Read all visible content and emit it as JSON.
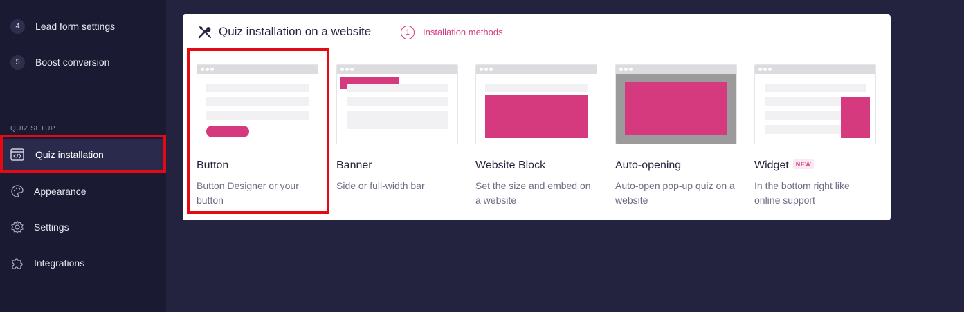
{
  "sidebar": {
    "steps": [
      {
        "num": "4",
        "label": "Lead form settings"
      },
      {
        "num": "5",
        "label": "Boost conversion"
      }
    ],
    "section_title": "QUIZ SETUP",
    "nav": [
      {
        "label": "Quiz installation",
        "icon": "code-window-icon",
        "active": true
      },
      {
        "label": "Appearance",
        "icon": "palette-icon"
      },
      {
        "label": "Settings",
        "icon": "gear-icon"
      },
      {
        "label": "Integrations",
        "icon": "puzzle-icon"
      }
    ]
  },
  "main": {
    "title": "Quiz installation on a website",
    "step_num": "1",
    "step_label": "Installation methods",
    "methods": [
      {
        "title": "Button",
        "desc": "Button Designer or your button"
      },
      {
        "title": "Banner",
        "desc": "Side or full-width bar"
      },
      {
        "title": "Website Block",
        "desc": "Set the size and embed on a website"
      },
      {
        "title": "Auto-opening",
        "desc": "Auto-open pop-up quiz on a website"
      },
      {
        "title": "Widget",
        "badge": "NEW",
        "desc": "In the bottom right like online support"
      }
    ]
  },
  "colors": {
    "accent": "#d63a7e",
    "sidebar_bg": "#1b1a33",
    "page_bg": "#23223f",
    "highlight": "#e50914"
  }
}
